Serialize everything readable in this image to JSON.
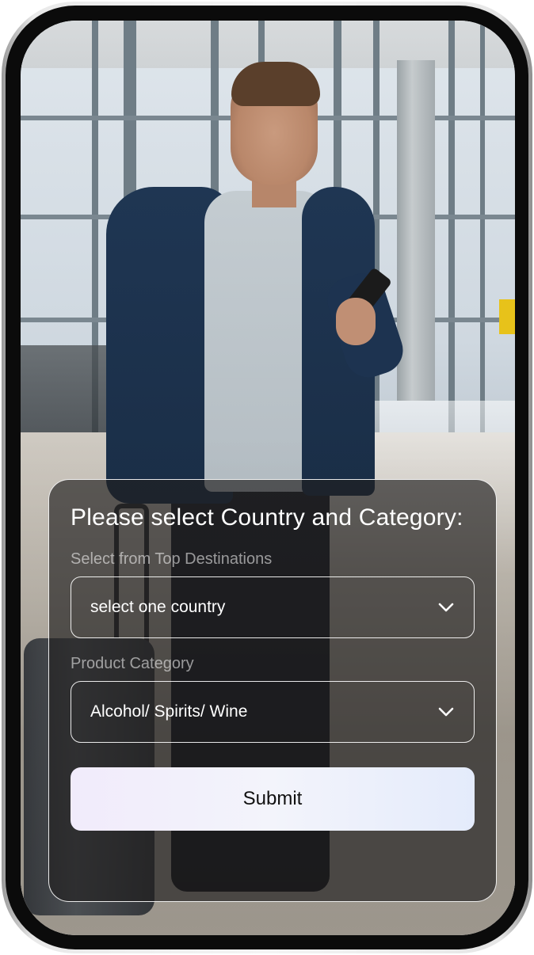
{
  "form": {
    "title": "Please select Country and Category:",
    "country_field": {
      "label": "Select from Top Destinations",
      "value": "select one country"
    },
    "category_field": {
      "label": "Product Category",
      "value": "Alcohol/ Spirits/ Wine"
    },
    "submit_label": "Submit"
  },
  "icons": {
    "dropdown": "chevron-down-icon"
  },
  "colors": {
    "card_background": "#201e1e",
    "card_border": "#ffffff",
    "button_gradient_start": "#f1ebfb",
    "button_gradient_end": "#e4ebfb",
    "text_primary": "#ffffff",
    "text_muted": "#8c8a8a"
  }
}
